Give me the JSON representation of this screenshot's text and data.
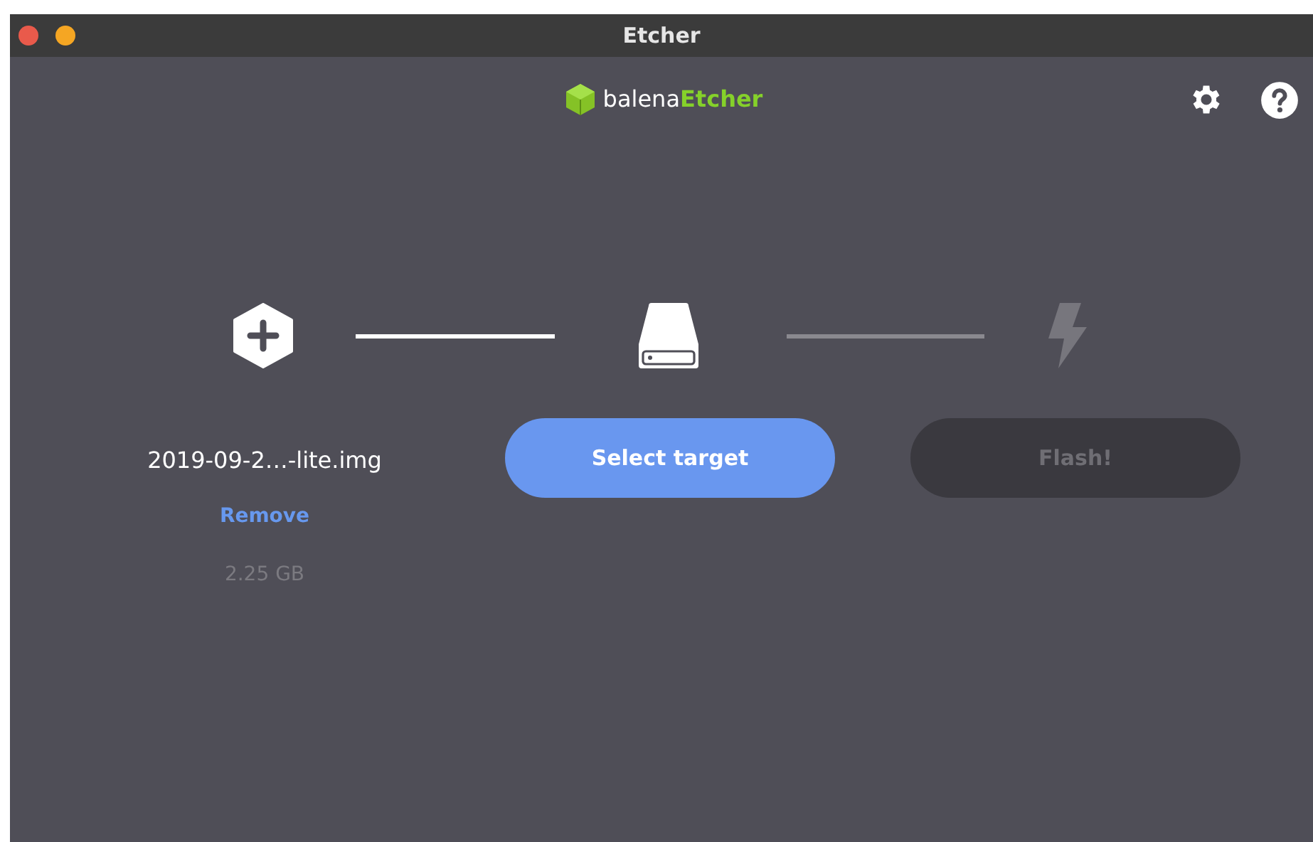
{
  "window": {
    "title": "Etcher"
  },
  "logo": {
    "prefix": "balena",
    "name": "Etcher"
  },
  "connectors": [
    {
      "completed": true
    },
    {
      "completed": false
    }
  ],
  "source": {
    "file_name": "2019-09-2…-lite.img",
    "action": "Remove",
    "size": "2.25 GB"
  },
  "target": {
    "button": "Select target",
    "disabled": false
  },
  "flash": {
    "button": "Flash!",
    "disabled": true
  }
}
